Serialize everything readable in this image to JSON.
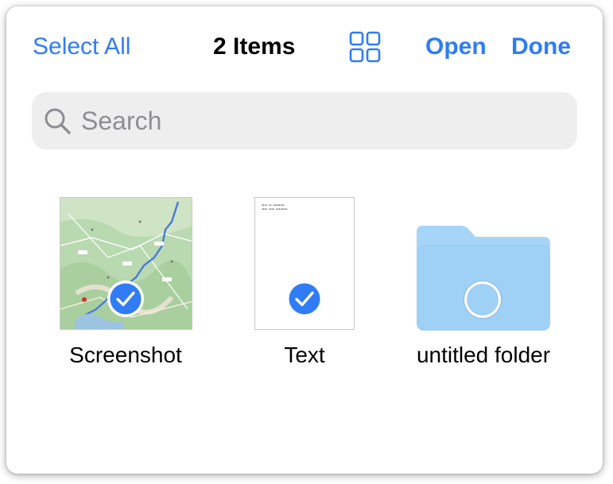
{
  "header": {
    "select_all_label": "Select All",
    "title": "2 Items",
    "view_toggle_icon": "grid-icon",
    "open_label": "Open",
    "done_label": "Done"
  },
  "search": {
    "placeholder": "Search",
    "icon": "magnifying-glass-icon"
  },
  "items": [
    {
      "name": "Screenshot",
      "kind": "image",
      "selected": true
    },
    {
      "name": "Text",
      "kind": "text",
      "selected": true
    },
    {
      "name": "untitled folder",
      "kind": "folder",
      "selected": false
    }
  ],
  "colors": {
    "accent": "#2f7cf6",
    "folder": "#9fd0f5",
    "search_bg": "#eeeeef"
  }
}
